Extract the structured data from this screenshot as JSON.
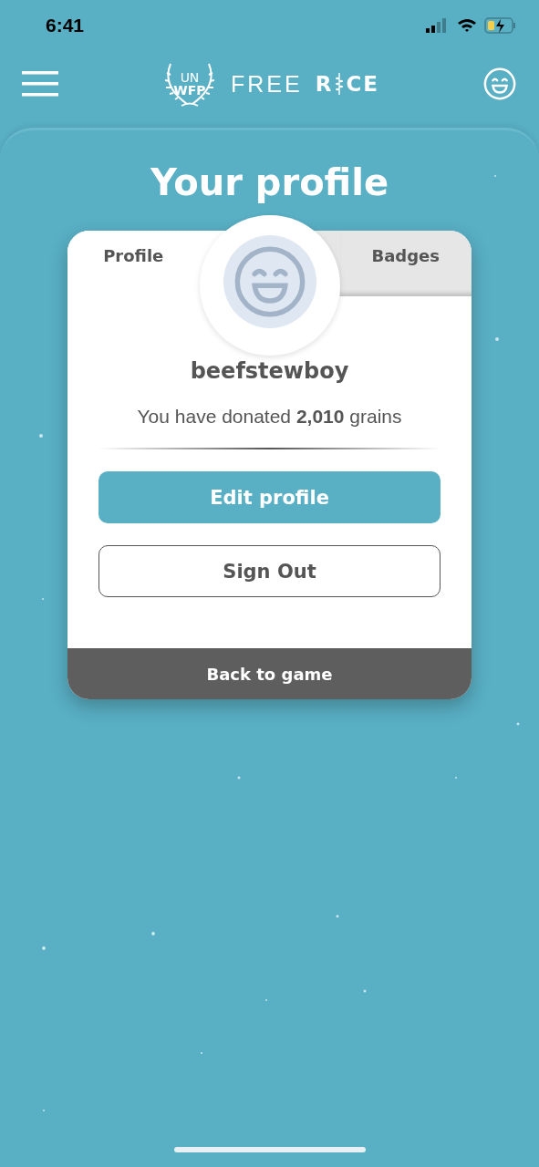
{
  "status_bar": {
    "time": "6:41"
  },
  "header": {
    "logo": {
      "un": "UN",
      "wfp": "WFP",
      "free": "FREE",
      "rice_start": "R",
      "rice_end": "CE"
    }
  },
  "title": "Your profile",
  "tabs": [
    {
      "label": "Profile",
      "selected": true
    },
    {
      "label": "Badges",
      "selected": false
    }
  ],
  "profile": {
    "username": "beefstewboy",
    "donated": "You have donated **2,010** grains"
  },
  "buttons": [
    {
      "label": "Edit profile",
      "kind": "primary"
    },
    {
      "label": "Sign Out",
      "kind": "outline"
    }
  ],
  "footer": {
    "label": "Back to game"
  }
}
